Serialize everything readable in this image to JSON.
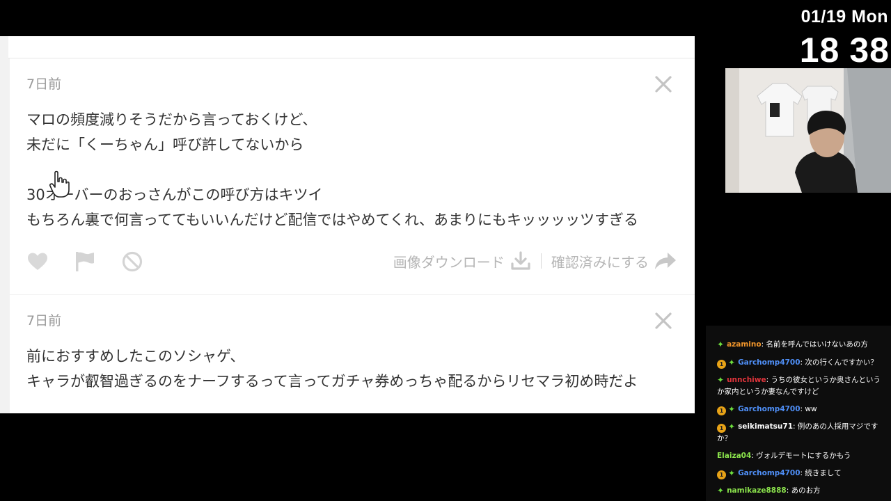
{
  "overlay": {
    "date": "01/19 Mon",
    "hour": "18",
    "minute": "38"
  },
  "cards": [
    {
      "timestamp": "7日前",
      "lines": [
        "マロの頻度減りそうだから言っておくけど、",
        "未だに「くーちゃん」呼び許してないから",
        "",
        "30オーバーのおっさんがこの呼び方はキツイ",
        "もちろん裏で何言っててもいいんだけど配信ではやめてくれ、あまりにもキッッッッツすぎる"
      ],
      "actions": {
        "download_label": "画像ダウンロード",
        "confirm_label": "確認済みにする"
      }
    },
    {
      "timestamp": "7日前",
      "lines": [
        "前におすすめしたこのソシャゲ、",
        "キャラが叡智過ぎるのをナーフするって言ってガチャ券めっちゃ配るからリセマラ初め時だよ"
      ]
    }
  ],
  "chat": {
    "colors": {
      "orange": "#f0952b",
      "blue": "#4f8ff7",
      "red": "#e0343b",
      "green": "#8be34c",
      "white": "#ffffff",
      "badge": "#e8a317",
      "star": "#6ddc3d"
    },
    "messages": [
      {
        "badge": "",
        "user": "azamino",
        "user_color": "#f0952b",
        "text": ": 名前を呼んではいけないあの方"
      },
      {
        "badge": "1",
        "user": "Garchomp4700",
        "user_color": "#4f8ff7",
        "text": ": 次の行くんですかい？"
      },
      {
        "badge": "",
        "user": "unnchiwe",
        "user_color": "#e0343b",
        "text": ": うちの彼女というか奥さんというか家内というか妻なんですけど"
      },
      {
        "badge": "1",
        "user": "Garchomp4700",
        "user_color": "#4f8ff7",
        "text": ": ww"
      },
      {
        "badge": "1",
        "user": "seikimatsu71",
        "user_color": "#ffffff",
        "text": ": 例のあの人採用マジですか？"
      },
      {
        "badge": "",
        "user": "Elaiza04",
        "user_color": "#8be34c",
        "text": ": ヴォルデモートにするかもう"
      },
      {
        "badge": "1",
        "user": "Garchomp4700",
        "user_color": "#4f8ff7",
        "text": ": 続きまして"
      },
      {
        "badge": "",
        "user": "namikaze8888",
        "user_color": "#8be34c",
        "text": ": あのお方"
      }
    ]
  }
}
